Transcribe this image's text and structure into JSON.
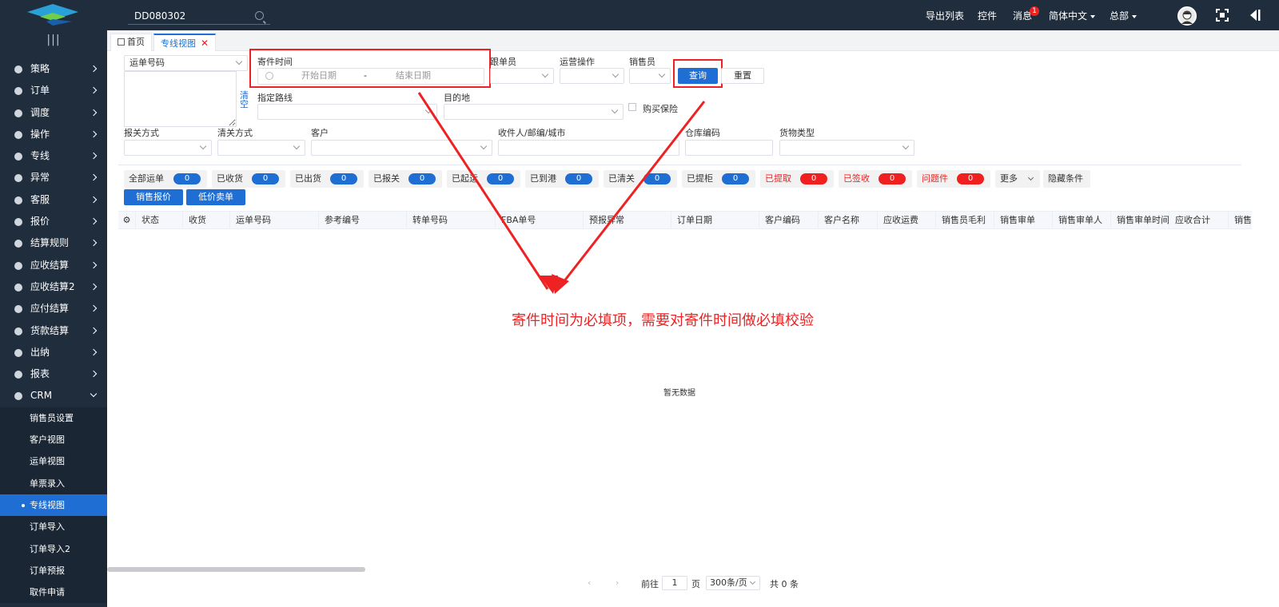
{
  "topbar": {
    "search_value": "DD080302",
    "export_list": "导出列表",
    "controls": "控件",
    "messages": "消息",
    "messages_badge": "1",
    "language": "简体中文",
    "org": "总部"
  },
  "sidebar": {
    "items": [
      {
        "label": "策略"
      },
      {
        "label": "订单"
      },
      {
        "label": "调度"
      },
      {
        "label": "操作"
      },
      {
        "label": "专线"
      },
      {
        "label": "异常"
      },
      {
        "label": "客服"
      },
      {
        "label": "报价"
      },
      {
        "label": "结算规则"
      },
      {
        "label": "应收结算"
      },
      {
        "label": "应收结算2"
      },
      {
        "label": "应付结算"
      },
      {
        "label": "货款结算"
      },
      {
        "label": "出纳"
      },
      {
        "label": "报表"
      },
      {
        "label": "CRM"
      }
    ],
    "sub_items": [
      {
        "label": "销售员设置"
      },
      {
        "label": "客户视图"
      },
      {
        "label": "运单视图"
      },
      {
        "label": "单票录入"
      },
      {
        "label": "专线视图"
      },
      {
        "label": "订单导入"
      },
      {
        "label": "订单导入2"
      },
      {
        "label": "订单预报"
      },
      {
        "label": "取件申请"
      }
    ]
  },
  "tabs": {
    "home": "首页",
    "current": "专线视图"
  },
  "filters": {
    "waybill_select": "运单号码",
    "clear": "清空",
    "send_time_label": "寄件时间",
    "start_date": "开始日期",
    "range_sep": "-",
    "end_date": "结束日期",
    "follower_label": "跟单员",
    "ops_label": "运营操作",
    "sales_label": "销售员",
    "query": "查询",
    "reset": "重置",
    "route_label": "指定路线",
    "destination_label": "目的地",
    "insurance_label": "购买保险",
    "customs_declare_label": "报关方式",
    "customs_clear_label": "清关方式",
    "customer_label": "客户",
    "recipient_label": "收件人/邮编/城市",
    "warehouse_label": "仓库编码",
    "goods_label": "货物类型"
  },
  "status_tabs": [
    {
      "label": "全部运单",
      "count": "0"
    },
    {
      "label": "已收货",
      "count": "0"
    },
    {
      "label": "已出货",
      "count": "0"
    },
    {
      "label": "已报关",
      "count": "0"
    },
    {
      "label": "已起运",
      "count": "0"
    },
    {
      "label": "已到港",
      "count": "0"
    },
    {
      "label": "已清关",
      "count": "0"
    },
    {
      "label": "已提柜",
      "count": "0"
    },
    {
      "label": "已提取",
      "count": "0"
    },
    {
      "label": "已签收",
      "count": "0"
    },
    {
      "label": "问题件",
      "count": "0"
    }
  ],
  "more": "更多",
  "hide_conditions": "隐藏条件",
  "actions": {
    "sales_quote": "销售报价",
    "low_price_sale": "低价卖单"
  },
  "table": {
    "columns": [
      "状态",
      "收货",
      "运单号码",
      "参考编号",
      "转单号码",
      "FBA单号",
      "预报异常",
      "订单日期",
      "客户编码",
      "客户名称",
      "应收运费",
      "销售员毛利",
      "销售审单",
      "销售审单人",
      "销售审单时间",
      "应收合计",
      "销售..."
    ],
    "empty_text": "暂无数据"
  },
  "annotation": "寄件时间为必填项，需要对寄件时间做必填校验",
  "pagination": {
    "goto_prefix": "前往",
    "page_value": "1",
    "page_suffix": "页",
    "page_size": "300条/页",
    "total": "共 0 条"
  },
  "colors": {
    "primary": "#1f6ed4",
    "danger": "#f02020",
    "sidebar_bg": "#1f2d3d"
  }
}
